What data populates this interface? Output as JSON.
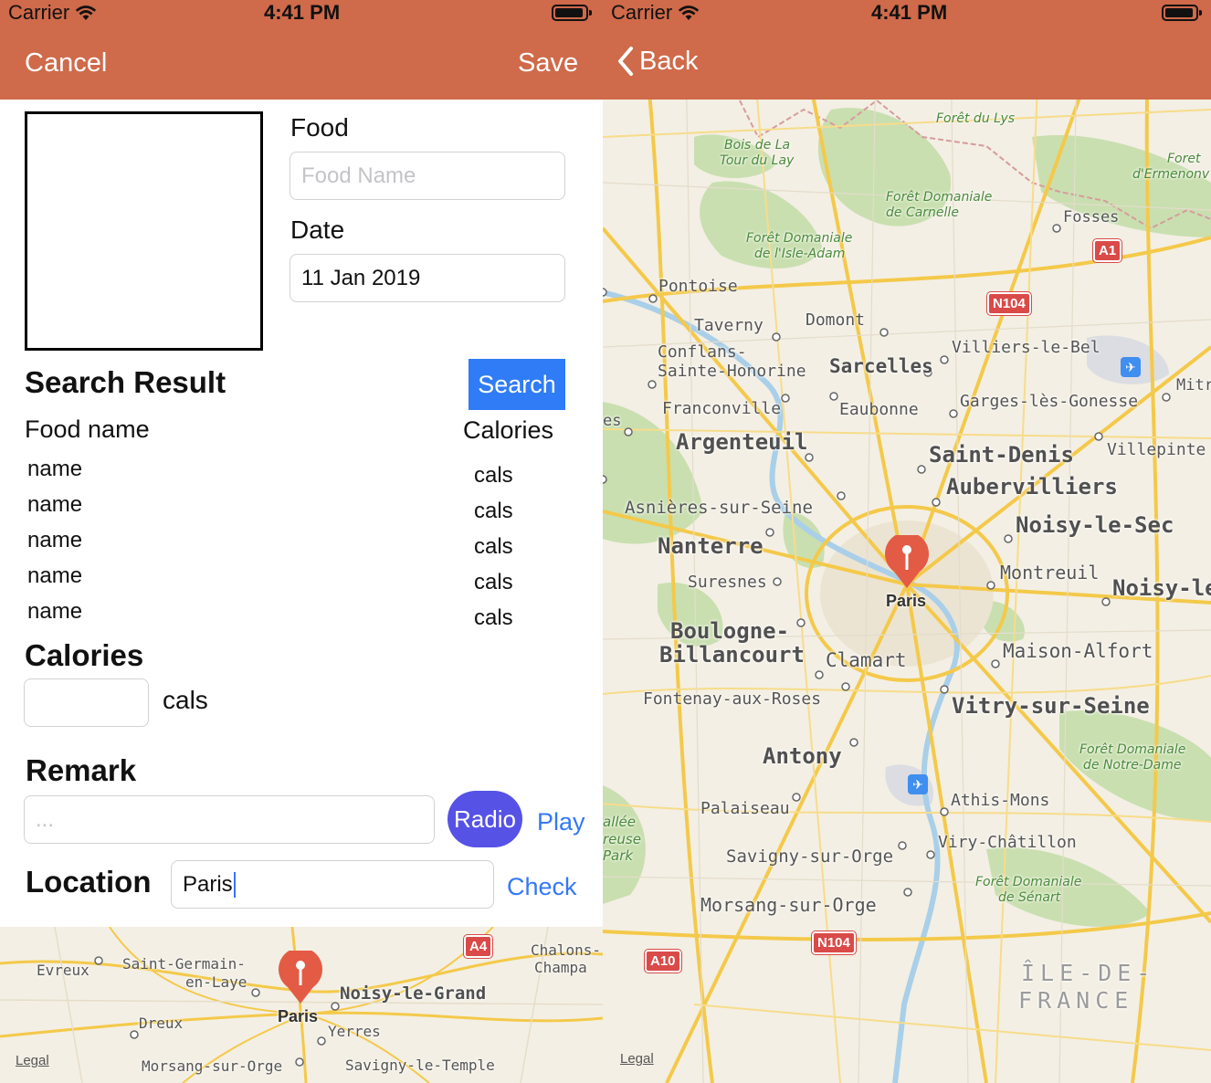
{
  "status_bar": {
    "carrier": "Carrier",
    "time": "4:41 PM"
  },
  "form_screen": {
    "nav": {
      "cancel_label": "Cancel",
      "save_label": "Save"
    },
    "food_label": "Food",
    "food_placeholder": "Food Name",
    "date_label": "Date",
    "date_value": "11 Jan 2019",
    "search_result_title": "Search Result",
    "search_button_label": "Search",
    "columns": {
      "name": "Food name",
      "calories": "Calories"
    },
    "results": [
      {
        "name": "name",
        "cals": "cals"
      },
      {
        "name": "name",
        "cals": "cals"
      },
      {
        "name": "name",
        "cals": "cals"
      },
      {
        "name": "name",
        "cals": "cals"
      },
      {
        "name": "name",
        "cals": "cals"
      }
    ],
    "calories_title": "Calories",
    "calories_unit": "cals",
    "remark_title": "Remark",
    "remark_placeholder": "...",
    "radio_button_label": "Radio",
    "play_link_label": "Play",
    "location_title": "Location",
    "location_value": "Paris",
    "check_link_label": "Check",
    "mini_map": {
      "labels": {
        "evreux": "Evreux",
        "saint_germain": "Saint-Germain-",
        "en_laye": "en-Laye",
        "chalons": "Chalons-",
        "champa": "Champa",
        "noisy_le_grand": "Noisy-le-Grand",
        "dreux": "Dreux",
        "paris": "Paris",
        "yerres": "Yerres",
        "morsang": "Morsang-sur-Orge",
        "savigny_temple": "Savigny-le-Temple"
      },
      "shield_a4": "A4",
      "legal": "Legal"
    }
  },
  "map_screen": {
    "nav": {
      "back_label": "Back"
    },
    "labels": {
      "foret_lys": "Forêt du Lys",
      "bois_lay_1": "Bois de La",
      "bois_lay_2": "Tour du Lay",
      "foret_ermenon_1": "Foret",
      "foret_ermenon_2": "d'Ermenonv",
      "carnelle_1": "Forêt Domaniale",
      "carnelle_2": "de Carnelle",
      "fosses": "Fosses",
      "isle_adam_1": "Forêt Domaniale",
      "isle_adam_2": "de l'Isle-Adam",
      "pontoise": "Pontoise",
      "taverny": "Taverny",
      "domont": "Domont",
      "villiers": "Villiers-le-Bel",
      "conflans_1": "Conflans-",
      "conflans_2": "Sainte-Honorine",
      "sarcelles": "Sarcelles",
      "mitr": "Mitr",
      "franconville": "Franconville",
      "eaubonne": "Eaubonne",
      "garges": "Garges-lès-Gonesse",
      "es": "es",
      "argenteuil": "Argenteuil",
      "saint_denis": "Saint-Denis",
      "villepinte": "Villepinte",
      "aubervilliers": "Aubervilliers",
      "asnieres": "Asnières-sur-Seine",
      "noisy_le_sec": "Noisy-le-Sec",
      "nanterre": "Nanterre",
      "suresnes": "Suresnes",
      "paris": "Paris",
      "montreuil": "Montreuil",
      "noisy_le": "Noisy-le",
      "boulogne_1": "Boulogne-",
      "boulogne_2": "Billancourt",
      "clamart": "Clamart",
      "maison_alfort": "Maison-Alfort",
      "fontenay": "Fontenay-aux-Roses",
      "vitry": "Vitry-sur-Seine",
      "notre_dame_1": "Forêt Domaniale",
      "notre_dame_2": "de Notre-Dame",
      "antony": "Antony",
      "palaiseau": "Palaiseau",
      "athis": "Athis-Mons",
      "vallee_1": "allée",
      "vallee_2": "reuse",
      "vallee_3": "Park",
      "viry": "Viry-Châtillon",
      "savigny_orge": "Savigny-sur-Orge",
      "senart_1": "Forêt Domaniale",
      "senart_2": "de Sénart",
      "morsang": "Morsang-sur-Orge",
      "idf_1": "ÎLE-DE-",
      "idf_2": "FRANCE"
    },
    "shields": {
      "a1": "A1",
      "n104_top": "N104",
      "n104_bottom": "N104",
      "a10": "A10"
    },
    "legal": "Legal"
  },
  "colors": {
    "nav_bar": "#cf6a4a",
    "search_button": "#2f7cf6",
    "radio_button": "#5652e6",
    "link": "#3478f6",
    "pin": "#e35b45",
    "map_land": "#f3efe4",
    "map_forest": "#c9dfb0",
    "map_road": "#f4c94a",
    "shield": "#d94a48"
  }
}
